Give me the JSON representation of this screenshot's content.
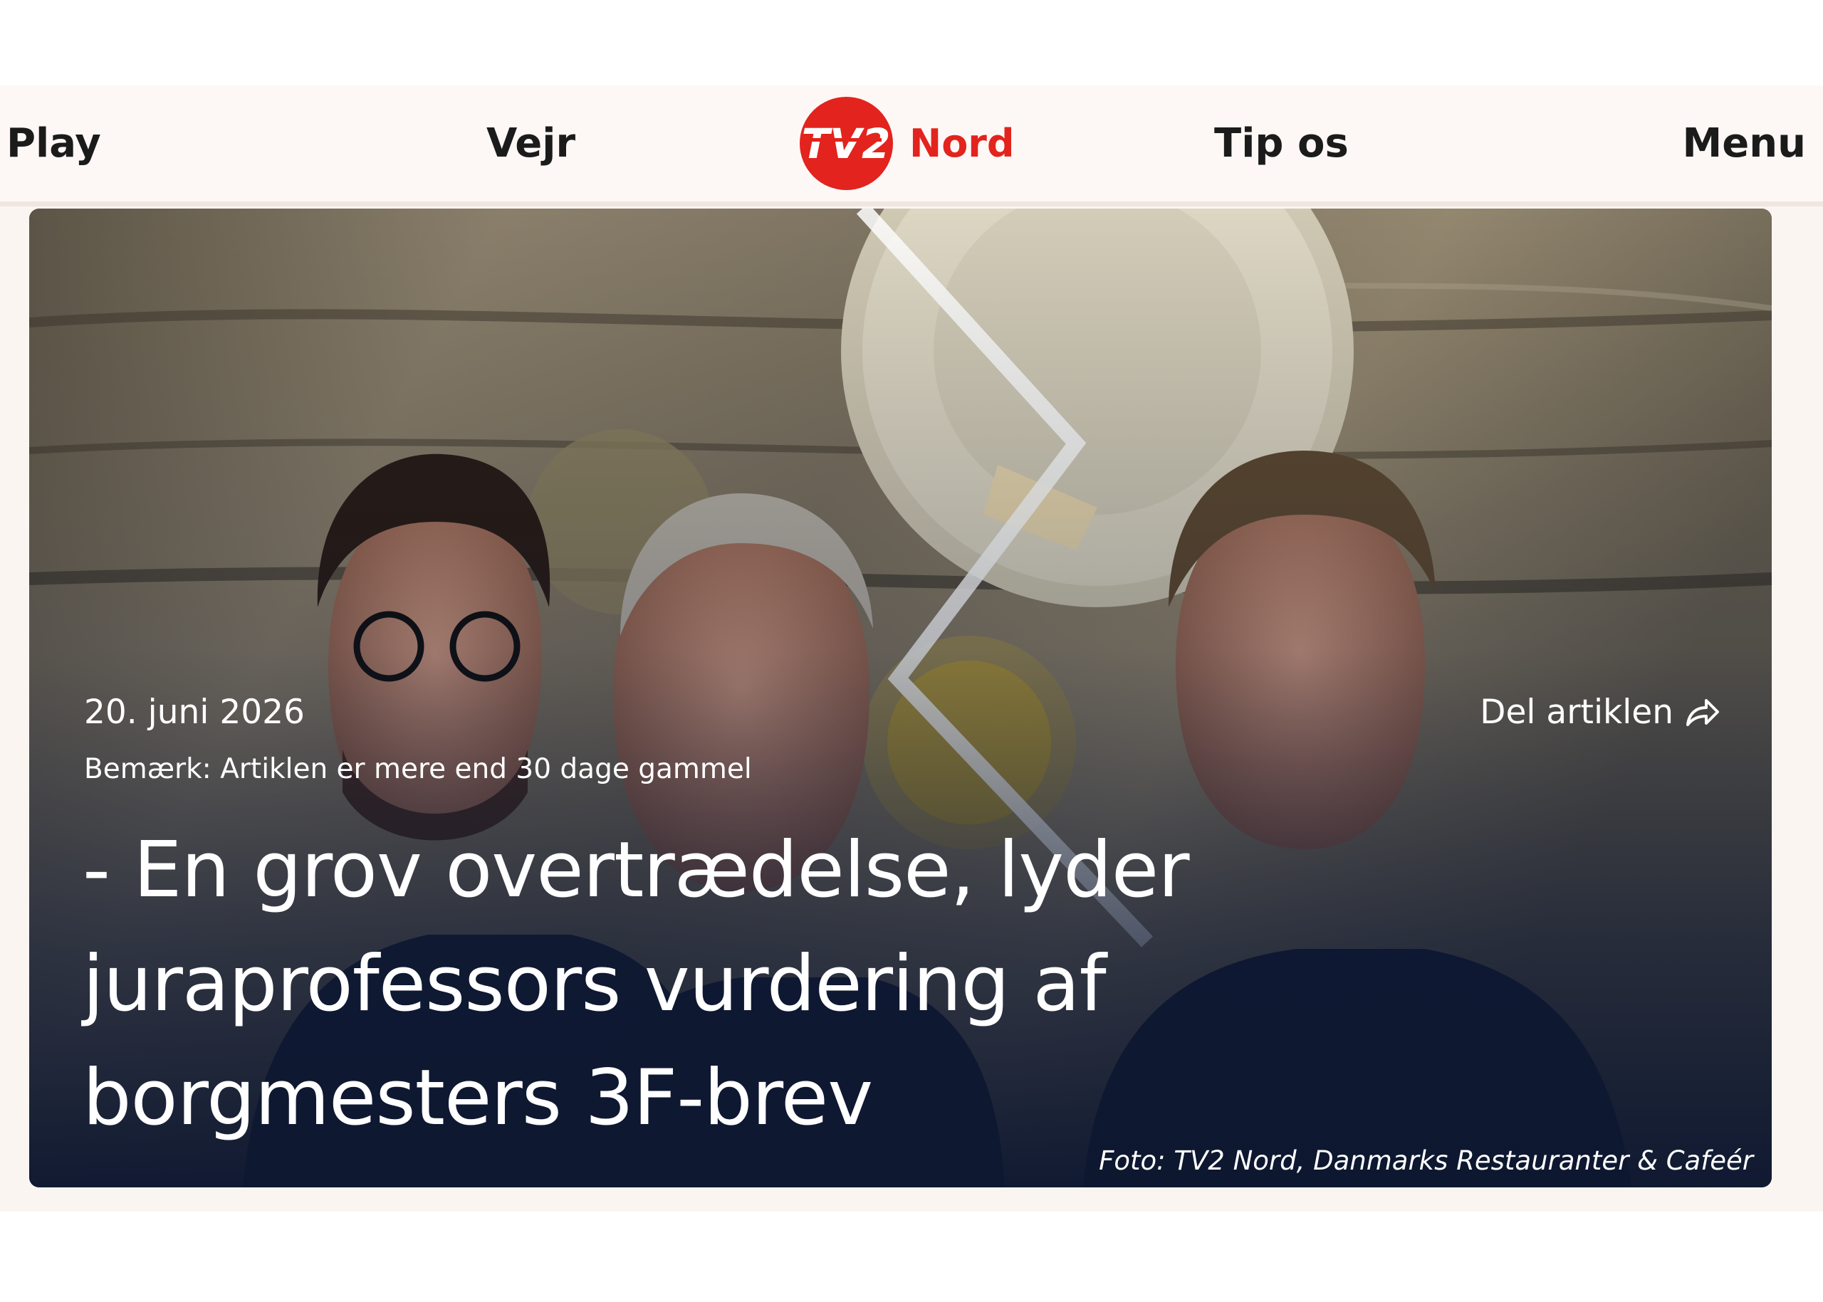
{
  "nav": {
    "play": "Play",
    "vejr": "Vejr",
    "brand": "Nord",
    "logo_text": "TV2",
    "tip": "Tip os",
    "menu": "Menu"
  },
  "article": {
    "date": "20. juni 2026",
    "notice": "Bemærk: Artiklen er mere end 30 dage gammel",
    "share_label": "Del artiklen",
    "headline": "- En grov overtrædelse, lyder juraprofessors vurdering af borgmesters 3F-brev",
    "photo_credit": "Foto: TV2 Nord, Danmarks Restauranter & Cafeér"
  },
  "colors": {
    "brand_red": "#e3231d",
    "header_bg": "#fdf8f6",
    "hero_bottom": "#0d1730"
  },
  "icons": {
    "share": "share-arrow-icon",
    "logo": "tv2-logo-icon"
  }
}
